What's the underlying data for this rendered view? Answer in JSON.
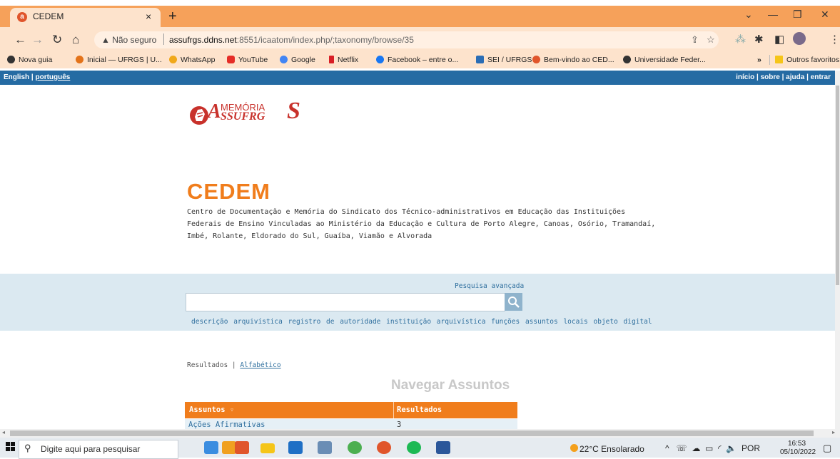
{
  "browser": {
    "tab_title": "CEDEM",
    "tab_close": "×",
    "new_tab": "+",
    "security_label": "▲ Não seguro",
    "url_host": "assufrgs.ddns.net",
    "url_rest": ":8551/icaatom/index.php/;taxonomy/browse/35",
    "bookmarks": [
      {
        "label": "Nova guia",
        "color": "#333333"
      },
      {
        "label": "Inicial — UFRGS | U...",
        "color": "#e3731a"
      },
      {
        "label": "WhatsApp",
        "color": "#f0a81a"
      },
      {
        "label": "YouTube",
        "color": "#e52d27"
      },
      {
        "label": "Google",
        "color": "#4285f4"
      },
      {
        "label": "Netflix",
        "color": "#d81f26"
      },
      {
        "label": "Facebook – entre o...",
        "color": "#1877f2"
      },
      {
        "label": "SEI / UFRGS",
        "color": "#2a6db5"
      },
      {
        "label": "Bem-vindo ao CED...",
        "color": "#e0552b"
      },
      {
        "label": "Universidade Feder...",
        "color": "#333333"
      }
    ],
    "bookmarks_more": "»",
    "other_bookmarks": "Outros favoritos"
  },
  "site": {
    "lang_en": "English",
    "lang_pt": "português",
    "top_links": "início | sobre | ajuda | entrar",
    "logo_small": "MEMÓRIA",
    "logo_big": "ASSUFRGS",
    "title": "CEDEM",
    "description": "Centro de Documentação e Memória do Sindicato dos Técnico-administrativos em Educação das Instituições Federais de Ensino Vinculadas ao Ministério da Educação e Cultura de Porto Alegre, Canoas, Osório, Tramandaí, Imbé, Rolante, Eldorado do Sul, Guaíba, Viamão e Alvorada",
    "advanced_search": "Pesquisa avançada",
    "search_links": [
      "descrição arquivística",
      "registro de autoridade",
      "instituição arquivística",
      "funções",
      "assuntos",
      "locais",
      "objeto digital"
    ],
    "results_label": "Resultados",
    "alphabetic_label": "Alfabético",
    "browse_title": "Navegar Assuntos",
    "table": {
      "col1": "Assuntos",
      "col2": "Resultados",
      "rows": [
        {
          "subject": "Ações Afirmativas",
          "count": "3"
        }
      ]
    }
  },
  "taskbar": {
    "search_placeholder": "Digite aqui para pesquisar",
    "weather": "22°C  Ensolarado",
    "lang": "POR",
    "time": "16:53",
    "date": "05/10/2022"
  },
  "colors": {
    "accent_orange": "#f07d1c",
    "chrome_orange": "#f6a15a",
    "site_blue": "#256ba3"
  }
}
